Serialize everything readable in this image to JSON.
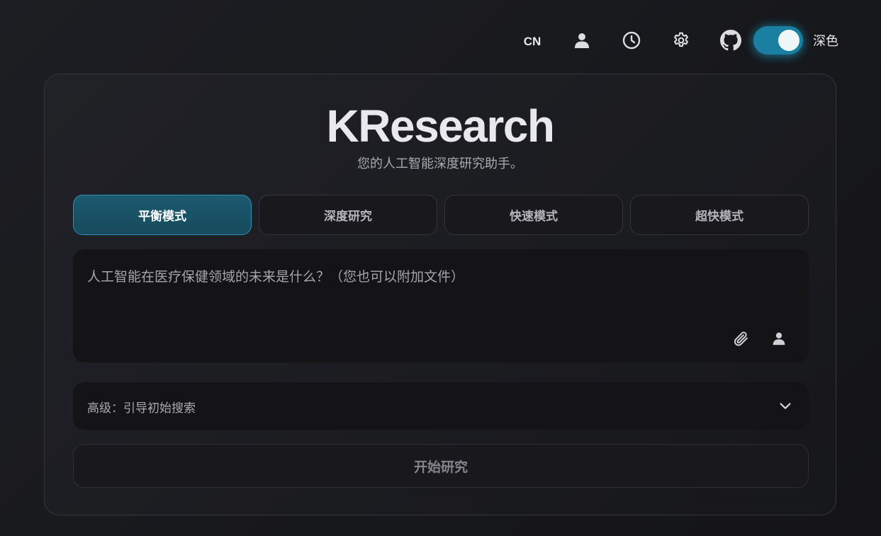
{
  "header": {
    "language": "CN",
    "icons": [
      "user-icon",
      "history-clock-icon",
      "settings-gear-icon",
      "github-icon"
    ],
    "theme_toggle_on": true,
    "theme_label": "深色",
    "accent_color": "#1b7fa1"
  },
  "app": {
    "title": "KResearch",
    "subtitle": "您的人工智能深度研究助手。"
  },
  "modes": [
    {
      "label": "平衡模式",
      "active": true
    },
    {
      "label": "深度研究",
      "active": false
    },
    {
      "label": "快速模式",
      "active": false
    },
    {
      "label": "超快模式",
      "active": false
    }
  ],
  "prompt": {
    "placeholder": "人工智能在医疗保健领域的未来是什么？（您也可以附加文件）",
    "icons": [
      "paperclip-icon",
      "user-icon"
    ]
  },
  "advanced": {
    "label": "高级：引导初始搜索",
    "icon": "chevron-down-icon"
  },
  "start_button": {
    "label": "开始研究"
  }
}
